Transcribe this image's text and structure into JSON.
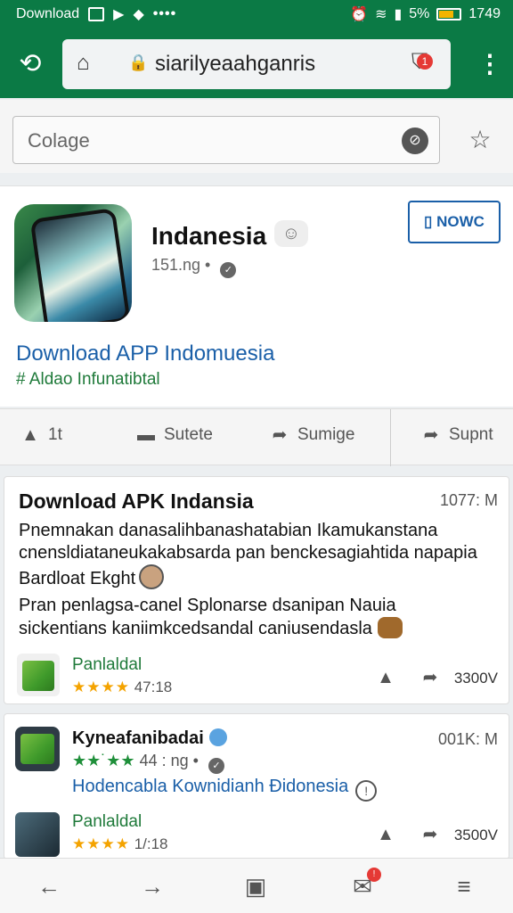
{
  "status_bar": {
    "left_label": "Download",
    "battery": "5%",
    "time": "1749",
    "icons": [
      "download-status-icon",
      "play-store-icon",
      "gift-icon",
      "more-dots-icon",
      "alarm-icon",
      "wifi-icon",
      "signal-icon",
      "battery-icon"
    ]
  },
  "browser": {
    "url": "siarilyeaahganris",
    "shield_badge": "1",
    "icons": [
      "back-icon",
      "home-icon",
      "lock-icon",
      "shield-icon",
      "kebab-menu-icon"
    ]
  },
  "search": {
    "placeholder": "Colage"
  },
  "app": {
    "title": "Indanesia",
    "subtitle": "151.ng •",
    "button_label": "NOWC",
    "link_text": "Download APP Indomuesia",
    "tag_text": "# Aldao Infunatibtal"
  },
  "actions": [
    {
      "label": "1t",
      "icon": "thumb-up-icon"
    },
    {
      "label": "Sutete",
      "icon": "comment-icon"
    },
    {
      "label": "Sumige",
      "icon": "share-icon"
    },
    {
      "label": "Supnt",
      "icon": "share-icon"
    }
  ],
  "post1": {
    "title": "Download APK Indansia",
    "meta": "1077: M",
    "body1": "Pnemnakan danasalihbanashatabian Ikamukanstana cnensldiataneukakabsarda pan benckesagiahtida napapia Bardloat Ekght",
    "body2": "Pran penlagsa-canel Splonarse dsanipan Nauia sickentians kaniimkcedsandal caniusendasla",
    "app_name": "Panlaldal",
    "rating_value": "47:18",
    "count": "3300V"
  },
  "post2": {
    "title": "Kyneafanibadai",
    "meta": "001K: M",
    "rating_text": "44 : ng •",
    "link_text": "Hodencabla Kownidianh Đidonesia",
    "app_name": "Panlaldal",
    "rating_value": "1/:18",
    "count": "3500V"
  },
  "colors": {
    "brand_green": "#0b7a45",
    "link_blue": "#1a5fa8",
    "text_green": "#1f7a3a",
    "star_gold": "#f4a300",
    "badge_red": "#e53935"
  }
}
